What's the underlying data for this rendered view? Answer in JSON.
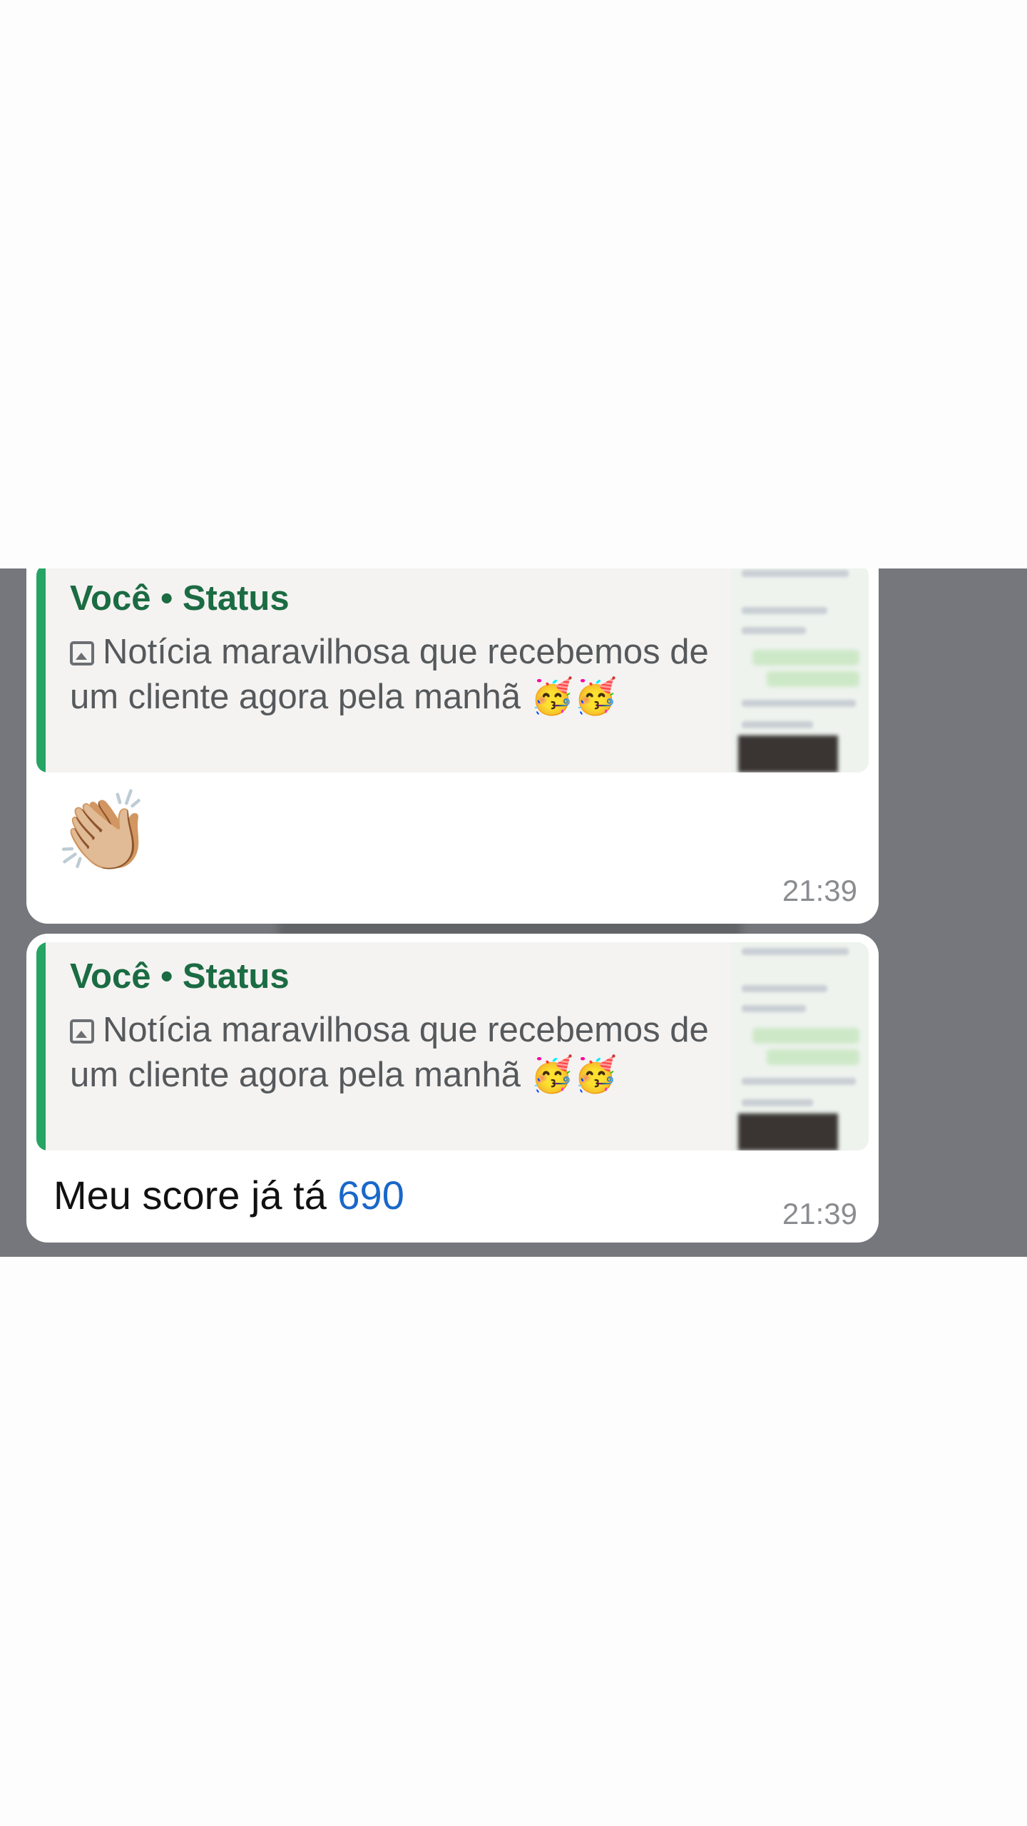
{
  "messages": [
    {
      "quote": {
        "author": "Você • Status",
        "text": "Notícia maravilhosa que recebemos de um cliente agora pela manhã 🥳🥳",
        "media_icon": "image-icon"
      },
      "body_emoji": "👏🏼",
      "time": "21:39"
    },
    {
      "quote": {
        "author": "Você • Status",
        "text": "Notícia maravilhosa que recebemos de um cliente agora pela manhã 🥳🥳",
        "media_icon": "image-icon"
      },
      "body_text": "Meu score já tá ",
      "body_number": "690",
      "time": "21:39"
    }
  ],
  "colors": {
    "chat_background": "#76777c",
    "bubble": "#ffffff",
    "quote_bar": "#25a464",
    "quote_author": "#1b6b43",
    "link_number": "#1a67c9"
  }
}
